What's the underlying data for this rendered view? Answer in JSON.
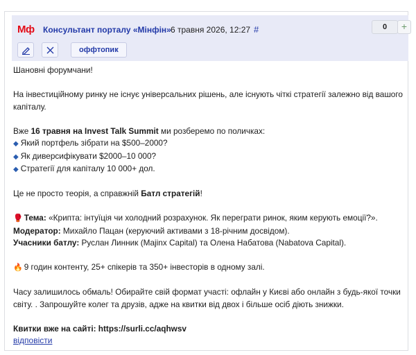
{
  "post": {
    "logo": "Мф",
    "author": "Консультант порталу «Мінфін»",
    "date": "6 травня 2026, 12:27",
    "hash": "#",
    "vote_count": "0",
    "vote_plus": "+",
    "tag": "оффтопик",
    "icons": [
      "edit-icon",
      "close-icon"
    ],
    "body": {
      "greeting": "Шановні форумчани!",
      "intro": "На інвестиційному ринку не існує універсальних рішень, але існують чіткі стратегії залежно від вашого капіталу.",
      "summit_pre": "Вже ",
      "summit_bold": "16 травня на Invest Talk Summit",
      "summit_post": " ми розберемо по поличках:",
      "bullets": [
        "Який портфель зібрати на $500–2000?",
        "Як диверсифікувати $2000–10 000?",
        "Стратегії для капіталу 10 000+ дол."
      ],
      "battle_pre": "Це не просто теорія, а справжній ",
      "battle_bold": "Батл стратегій",
      "battle_post": "!",
      "topic_label": "Тема:",
      "topic_text": " «Крипта: інтуїція чи холодний розрахунок. Як перегрaти ринок, яким керують емоції?».",
      "moderator_label": "Модератор:",
      "moderator_text": " Михайло Пацан (керуючий активами з 18-річним досвідом).",
      "participants_label": "Учасники батлу:",
      "participants_text": " Руслан Линник (Majinx Capital) та Олена Набатова (Nabatova Capital).",
      "content_line": "9 годин контенту, 25+ спікерів та 350+ інвесторів в одному залі.",
      "closing": "Часу залишилось обмаль! Обирайте свій формат участі: офлайн у Києві або онлайн з будь-якої точки світу. . Запрошуйте колег та друзів, адже на квитки від двох і більше осіб діють знижки.",
      "tickets": "Квитки вже на сайті: https://surli.cc/aqhwsv"
    },
    "reply": "відповісти"
  },
  "colors": {
    "header_bg": "#e8eaf7",
    "link": "#233aa8",
    "logo_red": "#e30b17"
  }
}
